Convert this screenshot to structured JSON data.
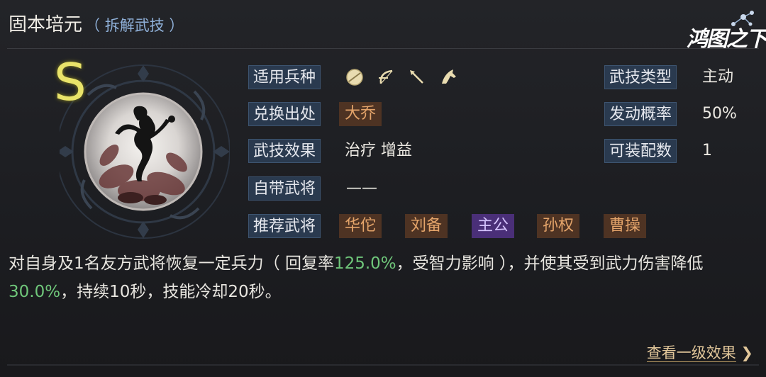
{
  "title": "固本培元",
  "subtitle": "（ 拆解武技 ）",
  "watermark": "鸿图之下",
  "grade": "S",
  "rows": {
    "troop_label": "适用兵种",
    "troop_icons": [
      "shield-icon",
      "bow-icon",
      "spear-icon",
      "horse-icon"
    ],
    "source_label": "兑换出处",
    "source_value": "大乔",
    "effect_label": "武技效果",
    "effect_value": "治疗  增益",
    "own_label": "自带武将",
    "own_value": "——",
    "recommend_label": "推荐武将",
    "recommend": [
      {
        "name": "华佗",
        "style": "brown"
      },
      {
        "name": "刘备",
        "style": "brown"
      },
      {
        "name": "主公",
        "style": "purple"
      },
      {
        "name": "孙权",
        "style": "brown"
      },
      {
        "name": "曹操",
        "style": "brown"
      }
    ],
    "type_label": "武技类型",
    "type_value": "主动",
    "prob_label": "发动概率",
    "prob_value": "50%",
    "equip_label": "可装配数",
    "equip_value": "1"
  },
  "description": {
    "p1": "对自身及1名友方武将恢复一定兵力（ 回复率",
    "h1": "125.0%",
    "p2": "，受智力影响 ），并使其受到武力伤害降低",
    "h2": "30.0%",
    "p3": "，持续10秒，技能冷却20秒。"
  },
  "footer": {
    "link": "查看一级效果",
    "arrow": "❯"
  },
  "colors": {
    "label_bg": "#2a3a4f",
    "grade": "#e9e36a",
    "highlight": "#6fc67a",
    "tag_brown": "#4e3323",
    "tag_purple": "#4a2f78",
    "link": "#e2c79a"
  }
}
